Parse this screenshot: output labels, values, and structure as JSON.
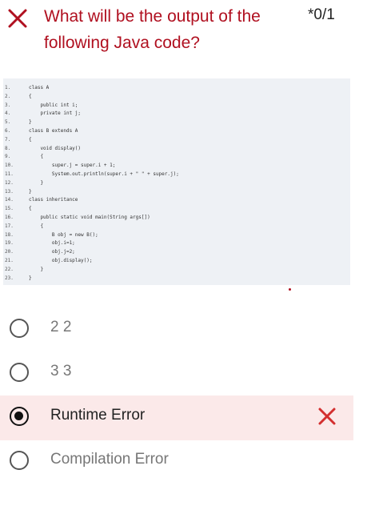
{
  "header": {
    "status_icon": "close-icon",
    "question": "What will be the output of the following Java code?",
    "score": "*0/1"
  },
  "code": {
    "lines": [
      {
        "n": "1.",
        "t": "class A"
      },
      {
        "n": "2.",
        "t": "{"
      },
      {
        "n": "3.",
        "t": "    public int i;"
      },
      {
        "n": "4.",
        "t": "    private int j;"
      },
      {
        "n": "5.",
        "t": "}"
      },
      {
        "n": "6.",
        "t": "class B extends A"
      },
      {
        "n": "7.",
        "t": "{"
      },
      {
        "n": "8.",
        "t": "    void display()"
      },
      {
        "n": "9.",
        "t": "    {"
      },
      {
        "n": "10.",
        "t": "        super.j = super.i + 1;"
      },
      {
        "n": "11.",
        "t": "        System.out.println(super.i + \" \" + super.j);"
      },
      {
        "n": "12.",
        "t": "    }"
      },
      {
        "n": "13.",
        "t": "}"
      },
      {
        "n": "14.",
        "t": "class inheritance"
      },
      {
        "n": "15.",
        "t": "{"
      },
      {
        "n": "16.",
        "t": "    public static void main(String args[])"
      },
      {
        "n": "17.",
        "t": "    {"
      },
      {
        "n": "18.",
        "t": "        B obj = new B();"
      },
      {
        "n": "19.",
        "t": "        obj.i=1;"
      },
      {
        "n": "20.",
        "t": "        obj.j=2;"
      },
      {
        "n": "21.",
        "t": "        obj.display();"
      },
      {
        "n": "22.",
        "t": "    }"
      },
      {
        "n": "23.",
        "t": "}"
      }
    ]
  },
  "options": [
    {
      "label": "2 2",
      "selected": false
    },
    {
      "label": "3 3",
      "selected": false
    },
    {
      "label": "Runtime Error",
      "selected": true,
      "marked_wrong": true
    },
    {
      "label": "Compilation Error",
      "selected": false
    }
  ],
  "colors": {
    "accent_red": "#b01020",
    "wrong_red": "#d32f2f",
    "selected_bg": "#fbe9e9",
    "code_bg": "#eef1f5"
  }
}
